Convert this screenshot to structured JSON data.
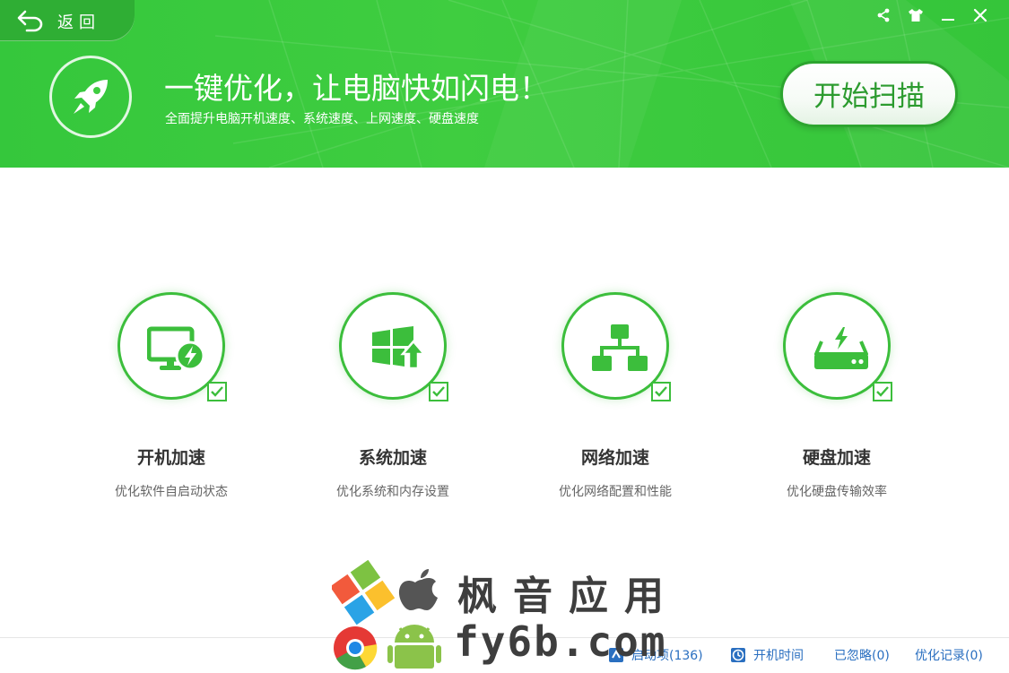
{
  "header": {
    "back_label": "返回",
    "headline": "一键优化，让电脑快如闪电！",
    "subline": "全面提升电脑开机速度、系统速度、上网速度、硬盘速度",
    "scan_button": "开始扫描",
    "window_controls": [
      "share-icon",
      "skin-icon",
      "minimize-icon",
      "close-icon"
    ]
  },
  "features": [
    {
      "title": "开机加速",
      "desc": "优化软件自启动状态",
      "icon": "monitor-lightning-icon",
      "checked": true
    },
    {
      "title": "系统加速",
      "desc": "优化系统和内存设置",
      "icon": "windows-upgrade-icon",
      "checked": true
    },
    {
      "title": "网络加速",
      "desc": "优化网络配置和性能",
      "icon": "network-topology-icon",
      "checked": true
    },
    {
      "title": "硬盘加速",
      "desc": "优化硬盘传输效率",
      "icon": "harddisk-icon",
      "checked": true
    }
  ],
  "footer": {
    "startup_items": "启动项(136)",
    "boot_time": "开机时间",
    "ignored": "已忽略(0)",
    "history": "优化记录(0)"
  },
  "watermark": {
    "cn": "枫音应用",
    "en": "fy6b.com"
  },
  "colors": {
    "header_green": "#3fcd40",
    "accent_green": "#3cbe3c",
    "link_blue": "#2a6fc0"
  }
}
